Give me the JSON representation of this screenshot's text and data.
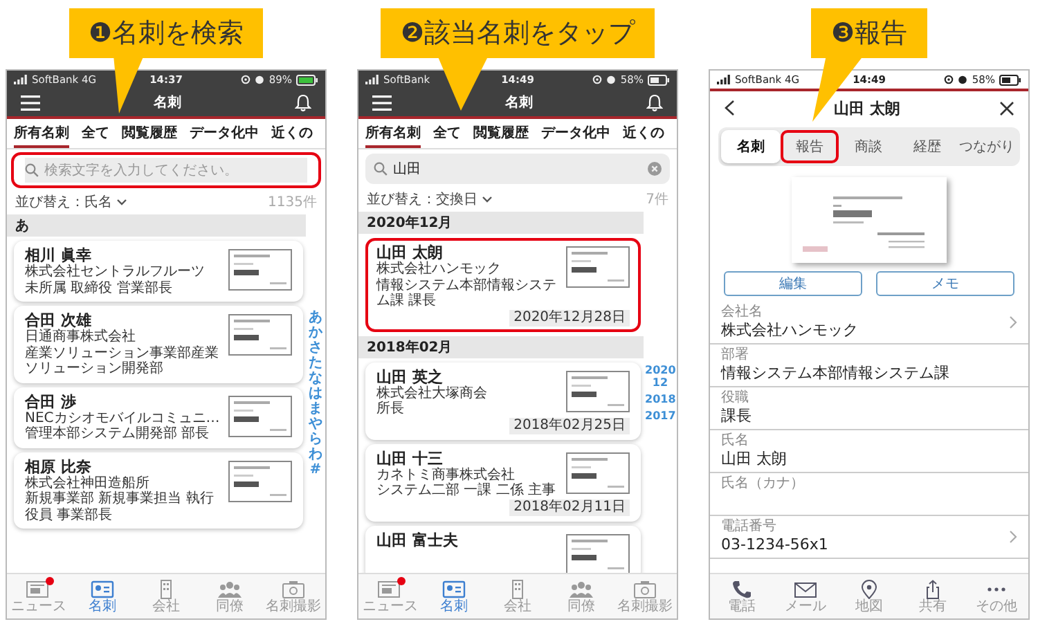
{
  "panels": [
    {
      "kind": "list",
      "callout": "❶名刺を検索",
      "status": {
        "carrier": "SoftBank 4G",
        "time": "14:37",
        "battery": "89%",
        "charging": true
      },
      "title": "名刺",
      "tabs": [
        {
          "label": "所有名刺",
          "selected": true
        },
        {
          "label": "全て",
          "selected": false
        },
        {
          "label": "閲覧履歴",
          "selected": false
        },
        {
          "label": "データ化中",
          "selected": false
        },
        {
          "label": "近くの",
          "selected": false
        }
      ],
      "search": {
        "placeholder": "検索文字を入力してください。",
        "highlighted": true
      },
      "sort": "並び替え：氏名",
      "count": "1135件",
      "sections": [
        {
          "title": "あ",
          "cards": [
            {
              "name": "相川 眞幸",
              "lines": [
                "株式会社セントラルフルーツ",
                "未所属 取締役 営業部長"
              ],
              "highlighted": false
            },
            {
              "name": "合田 次雄",
              "lines": [
                "日通商事株式会社",
                "産業ソリューション事業部産業ソリューション開発部"
              ],
              "highlighted": false
            },
            {
              "name": "合田 渉",
              "lines": [
                "NECカシオモバイルコミュニ…",
                "管理本部システム開発部 部長"
              ],
              "highlighted": false
            },
            {
              "name": "相原 比奈",
              "lines": [
                "株式会社神田造船所",
                "新規事業部 新規事業担当 執行役員 事業部長"
              ],
              "highlighted": false
            }
          ]
        }
      ],
      "index": [
        "あ",
        "か",
        "さ",
        "た",
        "な",
        "は",
        "ま",
        "や",
        "ら",
        "わ",
        "#"
      ],
      "nav": [
        {
          "label": "ニュース",
          "selected": false,
          "badge": true
        },
        {
          "label": "名刺",
          "selected": true,
          "badge": false
        },
        {
          "label": "会社",
          "selected": false,
          "badge": false
        },
        {
          "label": "同僚",
          "selected": false,
          "badge": false
        },
        {
          "label": "名刺撮影",
          "selected": false,
          "badge": false
        }
      ]
    },
    {
      "kind": "list",
      "callout": "❷該当名刺をタップ",
      "status": {
        "carrier": "SoftBank",
        "time": "14:49",
        "battery": "58%",
        "charging": false
      },
      "title": "名刺",
      "tabs": [
        {
          "label": "所有名刺",
          "selected": true
        },
        {
          "label": "全て",
          "selected": false
        },
        {
          "label": "閲覧履歴",
          "selected": false
        },
        {
          "label": "データ化中",
          "selected": false
        },
        {
          "label": "近くの",
          "selected": false
        }
      ],
      "search": {
        "value": "山田",
        "highlighted": false
      },
      "sort": "並び替え：交換日",
      "count": "7件",
      "sections": [
        {
          "title": "2020年12月",
          "cards": [
            {
              "name": "山田 太朗",
              "lines": [
                "株式会社ハンモック",
                "情報システム本部情報システム課 課長"
              ],
              "date": "2020年12月28日",
              "highlighted": true
            }
          ]
        },
        {
          "title": "2018年02月",
          "cards": [
            {
              "name": "山田 英之",
              "lines": [
                "株式会社大塚商会",
                "所長"
              ],
              "date": "2018年02月25日",
              "highlighted": false
            },
            {
              "name": "山田 十三",
              "lines": [
                "カネトミ商事株式会社",
                "システム二部 一課 二係 主事"
              ],
              "date": "2018年02月11日",
              "highlighted": false
            },
            {
              "name": "山田 富士夫",
              "highlighted": false
            }
          ]
        }
      ],
      "index": [
        "2020 12",
        "2018",
        "2017"
      ],
      "nav": [
        {
          "label": "ニュース",
          "selected": false,
          "badge": true
        },
        {
          "label": "名刺",
          "selected": true,
          "badge": false
        },
        {
          "label": "会社",
          "selected": false,
          "badge": false
        },
        {
          "label": "同僚",
          "selected": false,
          "badge": false
        },
        {
          "label": "名刺撮影",
          "selected": false,
          "badge": false
        }
      ]
    },
    {
      "kind": "detail",
      "callout": "❸報告",
      "status": {
        "carrier": "SoftBank 4G",
        "time": "14:49",
        "battery": "58%",
        "charging": false
      },
      "title": "山田 太朗",
      "segments": [
        {
          "label": "名刺",
          "selected": true,
          "highlighted": false
        },
        {
          "label": "報告",
          "selected": false,
          "highlighted": true
        },
        {
          "label": "商談",
          "selected": false,
          "highlighted": false
        },
        {
          "label": "経歴",
          "selected": false,
          "highlighted": false
        },
        {
          "label": "つながり",
          "selected": false,
          "highlighted": false
        }
      ],
      "buttons": [
        "編集",
        "メモ"
      ],
      "fields": [
        {
          "label": "会社名",
          "value": "株式会社ハンモック",
          "chevron": true
        },
        {
          "label": "部署",
          "value": "情報システム本部情報システム課",
          "chevron": false
        },
        {
          "label": "役職",
          "value": "課長",
          "chevron": false
        },
        {
          "label": "氏名",
          "value": "山田 太朗",
          "chevron": false
        },
        {
          "label": "氏名（カナ）",
          "chevron": false
        },
        {
          "label": "電話番号",
          "value": "03-1234-56x1",
          "chevron": true
        }
      ],
      "actions": [
        "電話",
        "メール",
        "地図",
        "共有",
        "その他"
      ]
    }
  ]
}
